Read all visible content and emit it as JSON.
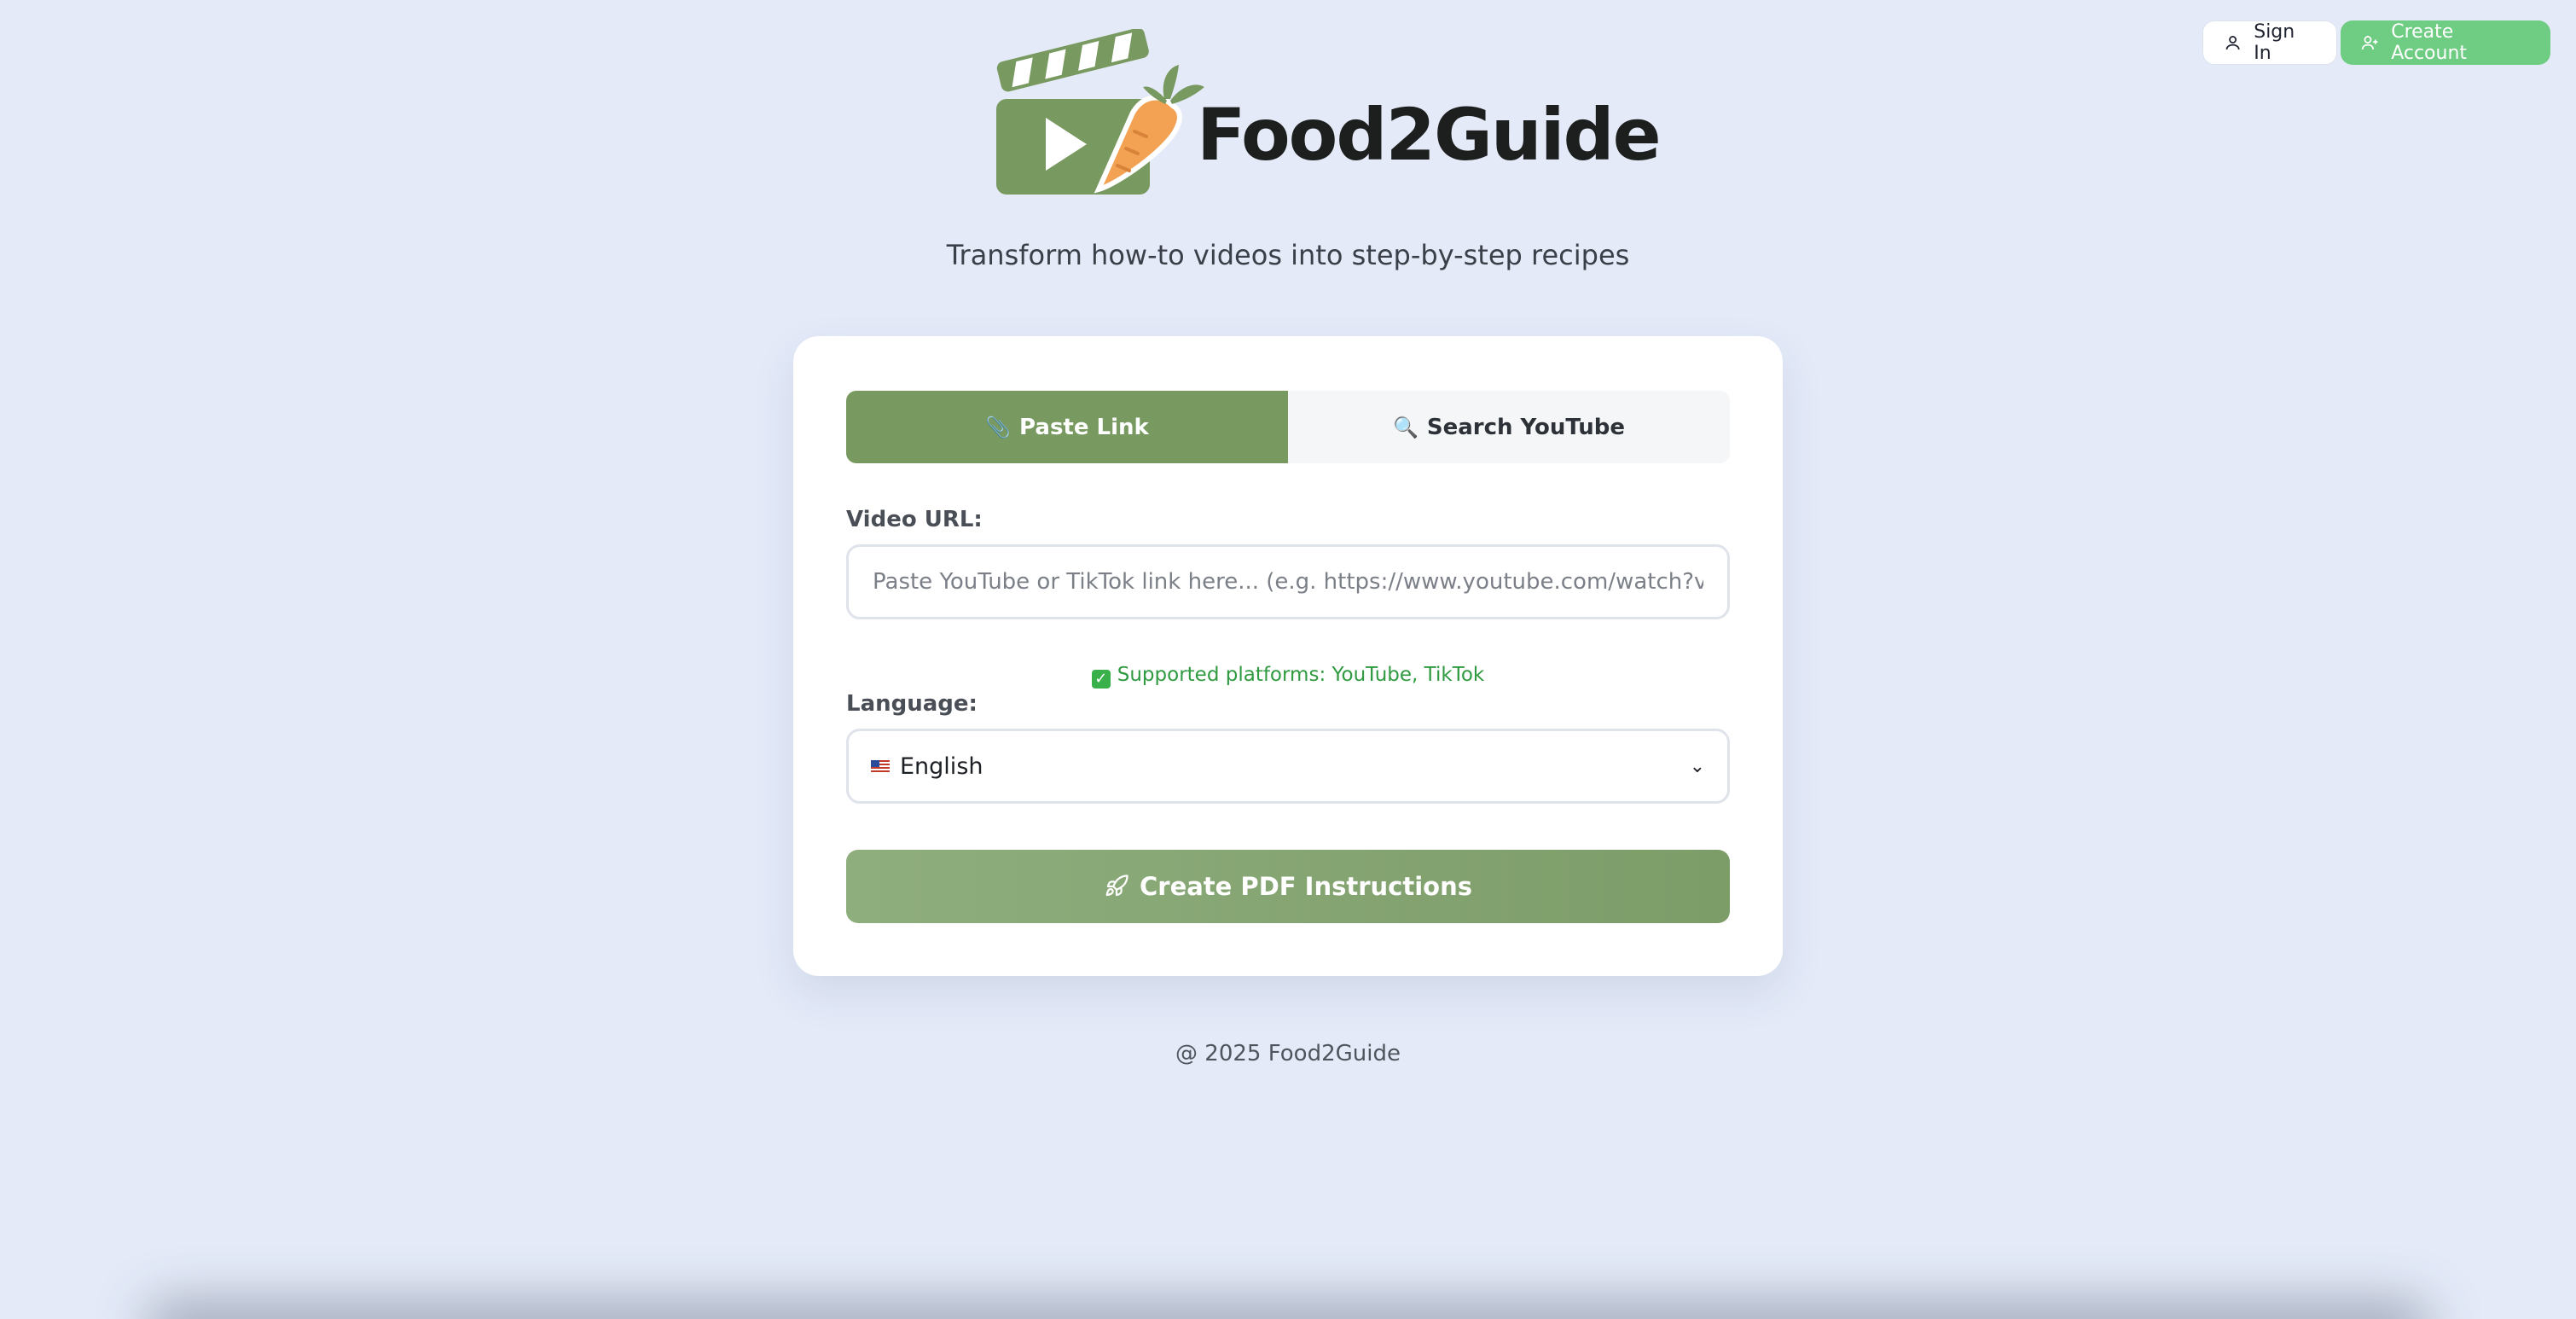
{
  "auth": {
    "sign_in_label": "Sign In",
    "create_account_label": "Create Account"
  },
  "brand": {
    "name": "Food2Guide",
    "tagline": "Transform how-to videos into step-by-step recipes"
  },
  "tabs": [
    {
      "label": "Paste Link",
      "icon": "paperclip-icon",
      "active": true
    },
    {
      "label": "Search YouTube",
      "icon": "magnifier-icon",
      "active": false
    }
  ],
  "form": {
    "url_label": "Video URL:",
    "url_placeholder": "Paste YouTube or TikTok link here... (e.g. https://www.youtube.com/watch?v=... or http",
    "url_value": "",
    "supported_text": "Supported platforms: YouTube, TikTok",
    "language_label": "Language:",
    "language_selected": "English",
    "submit_label": "Create PDF Instructions"
  },
  "footer": {
    "text": "@ 2025 Food2Guide"
  },
  "colors": {
    "background": "#e4eaf8",
    "accent_green": "#78995f",
    "create_account_green": "#6fcc83",
    "supported_green": "#2f9a40",
    "carrot_orange": "#f3a254"
  }
}
